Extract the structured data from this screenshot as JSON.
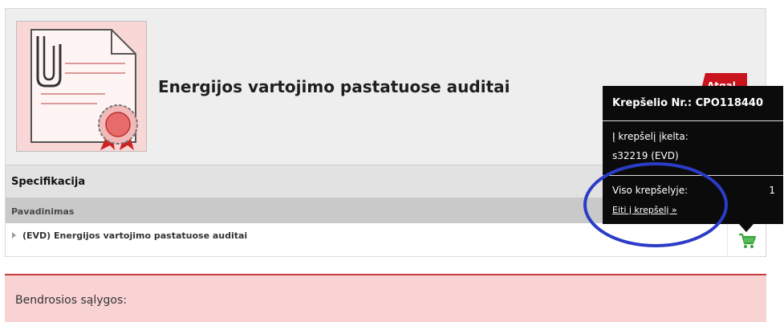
{
  "product": {
    "title": "Energijos vartojimo pastatuose auditai",
    "back_label": "Atgal"
  },
  "specification": {
    "heading": "Specifikacija",
    "column_header": "Pavadinimas",
    "items": [
      {
        "name": "(EVD) Energijos vartojimo pastatuose auditai"
      }
    ]
  },
  "terms": {
    "heading": "Bendrosios sąlygos:"
  },
  "cart_popup": {
    "title": "Krepšelio Nr.: CPO118440",
    "added_label": "Į krepšelį įkelta:",
    "added_value": "s32219 (EVD)",
    "total_label": "Viso krepšelyje:",
    "total_value": "1",
    "go_to_cart": "Eiti į krepšelį »"
  },
  "colors": {
    "accent_red": "#c9141d",
    "popup_bg": "#0b0b0b",
    "annotation_blue": "#2b3cc7",
    "cart_icon_green": "#3aa23a"
  },
  "icons": [
    "document-certificate-icon",
    "expand-arrow-icon",
    "add-to-cart-icon"
  ]
}
